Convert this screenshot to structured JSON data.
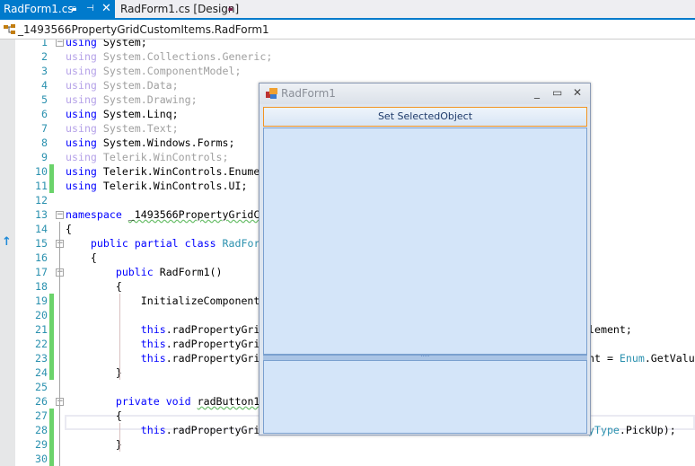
{
  "tabs": [
    {
      "label": "RadForm1.cs",
      "active": true,
      "icons": [
        "lock-icon",
        "pin-icon",
        "close-icon"
      ]
    },
    {
      "label": "RadForm1.cs [Design]",
      "active": false,
      "icons": [
        "lock-icon"
      ]
    }
  ],
  "nav": {
    "path": "_1493566PropertyGridCustomItems.RadForm1"
  },
  "colors": {
    "accent": "#007acc",
    "keyword": "#0000ff",
    "type": "#2b91af",
    "changed": "#6bd36b",
    "form_bg": "#d4e5f9",
    "button_border": "#f29422"
  },
  "code": {
    "lines": [
      {
        "n": "1",
        "seg": [
          [
            "using",
            "kw"
          ],
          [
            " System;",
            ""
          ]
        ]
      },
      {
        "n": "2",
        "seg": [
          [
            "using",
            "gk"
          ],
          [
            " System.Collections.Generic;",
            "gt"
          ]
        ]
      },
      {
        "n": "3",
        "seg": [
          [
            "using",
            "gk"
          ],
          [
            " System.ComponentModel;",
            "gt"
          ]
        ]
      },
      {
        "n": "4",
        "seg": [
          [
            "using",
            "gk"
          ],
          [
            " System.Data;",
            "gt"
          ]
        ]
      },
      {
        "n": "5",
        "seg": [
          [
            "using",
            "gk"
          ],
          [
            " System.Drawing;",
            "gt"
          ]
        ]
      },
      {
        "n": "6",
        "seg": [
          [
            "using",
            "kw"
          ],
          [
            " System.Linq;",
            ""
          ]
        ]
      },
      {
        "n": "7",
        "seg": [
          [
            "using",
            "gk"
          ],
          [
            " System.Text;",
            "gt"
          ]
        ]
      },
      {
        "n": "8",
        "seg": [
          [
            "using",
            "kw"
          ],
          [
            " System.Windows.Forms;",
            ""
          ]
        ]
      },
      {
        "n": "9",
        "seg": [
          [
            "using",
            "gk"
          ],
          [
            " Telerik.WinControls;",
            "gt"
          ]
        ]
      },
      {
        "n": "10",
        "seg": [
          [
            "using",
            "kw"
          ],
          [
            " Telerik.WinControls.Enume",
            ""
          ]
        ]
      },
      {
        "n": "11",
        "seg": [
          [
            "using",
            "kw"
          ],
          [
            " Telerik.WinControls.UI;",
            ""
          ]
        ]
      },
      {
        "n": "12",
        "seg": []
      },
      {
        "n": "13",
        "seg": [
          [
            "namespace",
            "kw"
          ],
          [
            " ",
            ""
          ],
          [
            "_1493566PropertyGridC",
            "sq"
          ]
        ]
      },
      {
        "n": "14",
        "seg": [
          [
            "{",
            ""
          ]
        ]
      },
      {
        "n": "15",
        "seg": [
          [
            "    ",
            ""
          ],
          [
            "public",
            "kw"
          ],
          [
            " ",
            ""
          ],
          [
            "partial",
            "kw"
          ],
          [
            " ",
            ""
          ],
          [
            "class",
            "kw"
          ],
          [
            " ",
            ""
          ],
          [
            "RadFor",
            "ty"
          ]
        ]
      },
      {
        "n": "16",
        "seg": [
          [
            "    {",
            ""
          ]
        ]
      },
      {
        "n": "17",
        "seg": [
          [
            "        ",
            ""
          ],
          [
            "public",
            "kw"
          ],
          [
            " RadForm1()",
            ""
          ]
        ]
      },
      {
        "n": "18",
        "seg": [
          [
            "        {",
            ""
          ]
        ]
      },
      {
        "n": "19",
        "seg": [
          [
            "            InitializeComponent",
            ""
          ]
        ]
      },
      {
        "n": "20",
        "seg": []
      },
      {
        "n": "21",
        "seg": [
          [
            "            ",
            ""
          ],
          [
            "this",
            "kw"
          ],
          [
            ".radPropertyGri",
            ""
          ]
        ],
        "tail": [
          [
            "lement;",
            ""
          ]
        ]
      },
      {
        "n": "22",
        "seg": [
          [
            "            ",
            ""
          ],
          [
            "this",
            "kw"
          ],
          [
            ".radPropertyGri",
            ""
          ]
        ]
      },
      {
        "n": "23",
        "seg": [
          [
            "            ",
            ""
          ],
          [
            "this",
            "kw"
          ],
          [
            ".radPropertyGri",
            ""
          ]
        ],
        "tail": [
          [
            "nt = ",
            ""
          ],
          [
            "Enum",
            "ty"
          ],
          [
            ".GetValu",
            ""
          ]
        ]
      },
      {
        "n": "24",
        "seg": [
          [
            "        }",
            ""
          ]
        ]
      },
      {
        "n": "25",
        "seg": []
      },
      {
        "n": "26",
        "seg": [
          [
            "        ",
            ""
          ],
          [
            "private",
            "kw"
          ],
          [
            " ",
            ""
          ],
          [
            "void",
            "kw"
          ],
          [
            " ",
            ""
          ],
          [
            "radButton1",
            "sq"
          ]
        ]
      },
      {
        "n": "27",
        "seg": [
          [
            "        {",
            ""
          ]
        ]
      },
      {
        "n": "28",
        "seg": [
          [
            "            ",
            ""
          ],
          [
            "this",
            "kw"
          ],
          [
            ".radPropertyGri",
            ""
          ]
        ],
        "tail": [
          [
            "yType",
            "ty"
          ],
          [
            ".PickUp);",
            ""
          ]
        ]
      },
      {
        "n": "29",
        "seg": [
          [
            "        }",
            ""
          ]
        ]
      },
      {
        "n": "30",
        "seg": []
      }
    ]
  },
  "form": {
    "title": "RadForm1",
    "button_label": "Set SelectedObject"
  }
}
